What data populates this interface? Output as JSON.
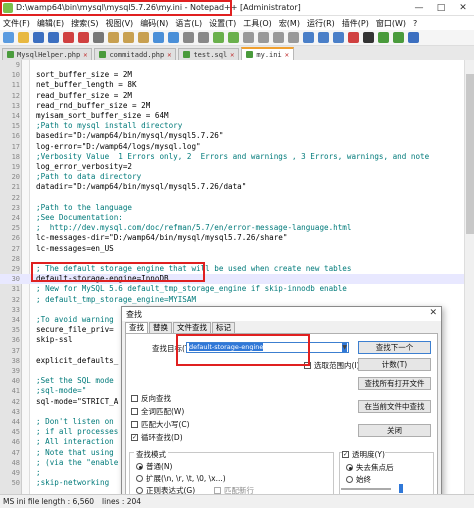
{
  "window": {
    "title": "D:\\wamp64\\bin\\mysql\\mysql5.7.26\\my.ini - Notepad++ [Administrator]",
    "controls": [
      "—",
      "□",
      "✕"
    ]
  },
  "menu": [
    "文件(F)",
    "编辑(E)",
    "搜索(S)",
    "视图(V)",
    "编码(N)",
    "语言(L)",
    "设置(T)",
    "工具(O)",
    "宏(M)",
    "运行(R)",
    "插件(P)",
    "窗口(W)",
    "?"
  ],
  "tabs": [
    {
      "label": "MysqlHelper.php",
      "close": "✕"
    },
    {
      "label": "commitadd.php",
      "close": "✕"
    },
    {
      "label": "test.sql",
      "close": "✕"
    },
    {
      "label": "my.ini",
      "close": "✕"
    }
  ],
  "editor": {
    "lines": [
      {
        "n": "9",
        "text": "",
        "c": false
      },
      {
        "n": "10",
        "text": "sort_buffer_size = 2M",
        "c": false
      },
      {
        "n": "11",
        "text": "net_buffer_length = 8K",
        "c": false
      },
      {
        "n": "12",
        "text": "read_buffer_size = 2M",
        "c": false
      },
      {
        "n": "13",
        "text": "read_rnd_buffer_size = 2M",
        "c": false
      },
      {
        "n": "14",
        "text": "myisam_sort_buffer_size = 64M",
        "c": false
      },
      {
        "n": "15",
        "text": ";Path to mysql install directory",
        "c": true
      },
      {
        "n": "16",
        "text": "basedir=\"D:/wamp64/bin/mysql/mysql5.7.26\"",
        "c": false
      },
      {
        "n": "17",
        "text": "log-error=\"D:/wamp64/logs/mysql.log\"",
        "c": false
      },
      {
        "n": "18",
        "text": ";Verbosity Value  1 Errors only, 2  Errors and warnings , 3 Errors, warnings, and note",
        "c": true
      },
      {
        "n": "19",
        "text": "log_error_verbosity=2",
        "c": false
      },
      {
        "n": "20",
        "text": ";Path to data directory",
        "c": true
      },
      {
        "n": "21",
        "text": "datadir=\"D:/wamp64/bin/mysql/mysql5.7.26/data\"",
        "c": false
      },
      {
        "n": "22",
        "text": "",
        "c": false
      },
      {
        "n": "23",
        "text": ";Path to the language",
        "c": true
      },
      {
        "n": "24",
        "text": ";See Documentation:",
        "c": true
      },
      {
        "n": "25",
        "text": ";  http://dev.mysql.com/doc/refman/5.7/en/error-message-language.html",
        "c": true
      },
      {
        "n": "26",
        "text": "lc-messages-dir=\"D:/wamp64/bin/mysql/mysql5.7.26/share\"",
        "c": false
      },
      {
        "n": "27",
        "text": "lc-messages=en_US",
        "c": false
      },
      {
        "n": "28",
        "text": "",
        "c": false
      },
      {
        "n": "29",
        "text": "; The default storage engine that will be used when create new tables",
        "c": true
      },
      {
        "n": "30",
        "text": "default-storage-engine=InnoDB",
        "c": false
      },
      {
        "n": "31",
        "text": "; New for MySQL 5.6 default_tmp_storage_engine if skip-innodb enable",
        "c": true
      },
      {
        "n": "32",
        "text": "; default_tmp_storage_engine=MYISAM",
        "c": true
      },
      {
        "n": "33",
        "text": "",
        "c": false
      },
      {
        "n": "34",
        "text": ";To avoid warning",
        "c": true
      },
      {
        "n": "35",
        "text": "secure_file_priv=",
        "c": false
      },
      {
        "n": "36",
        "text": "skip-ssl",
        "c": false
      },
      {
        "n": "37",
        "text": "",
        "c": false
      },
      {
        "n": "38",
        "text": "explicit_defaults_",
        "c": false
      },
      {
        "n": "39",
        "text": "",
        "c": false
      },
      {
        "n": "40",
        "text": ";Set the SQL mode",
        "c": true
      },
      {
        "n": "41",
        "text": ";sql-mode=\"",
        "c": true
      },
      {
        "n": "42",
        "text": "sql-mode=\"STRICT_A",
        "c": false
      },
      {
        "n": "43",
        "text": "",
        "c": false
      },
      {
        "n": "44",
        "text": "; Don't listen on",
        "c": true
      },
      {
        "n": "45",
        "text": "; if all processes",
        "c": true
      },
      {
        "n": "46",
        "text": "; All interaction",
        "c": true
      },
      {
        "n": "47",
        "text": "; Note that using",
        "c": true
      },
      {
        "n": "48",
        "text": "; (via the \"enable",
        "c": true
      },
      {
        "n": "49",
        "text": ";",
        "c": true
      },
      {
        "n": "50",
        "text": ";skip-networking",
        "c": true
      }
    ]
  },
  "dialog": {
    "title": "查找",
    "close": "✕",
    "tabs": [
      "查找",
      "替换",
      "文件查找",
      "标记"
    ],
    "find_label": "查找目标(T):",
    "find_value": "default-storage-engine",
    "buttons": {
      "find_next": "查找下一个",
      "count": "计数(T)",
      "find_all_open": "查找所有打开文件",
      "find_all_current": "在当前文件中查找",
      "close": "关闭"
    },
    "in_selection": "选取范围内(I)",
    "checks": [
      "反向查找",
      "全词匹配(W)",
      "匹配大小写(C)",
      "循环查找(D)"
    ],
    "checks_on": [
      false,
      false,
      false,
      true
    ],
    "mode_title": "查找模式",
    "modes": [
      "普通(N)",
      "扩展(\\n, \\r, \\t, \\0, \\x...)",
      "正则表达式(G)"
    ],
    "dotall": "匹配新行",
    "transparency_title": "透明度(Y)",
    "transparency_opts": [
      "失去焦点后",
      "始终"
    ]
  },
  "statusbar": {
    "text": "MS ini file",
    "length": "length : 6,560",
    "lines": "lines : 204"
  },
  "colors": {
    "highlight_box": "#e02020",
    "comment": "#007a7a",
    "selection": "#3078d8"
  }
}
